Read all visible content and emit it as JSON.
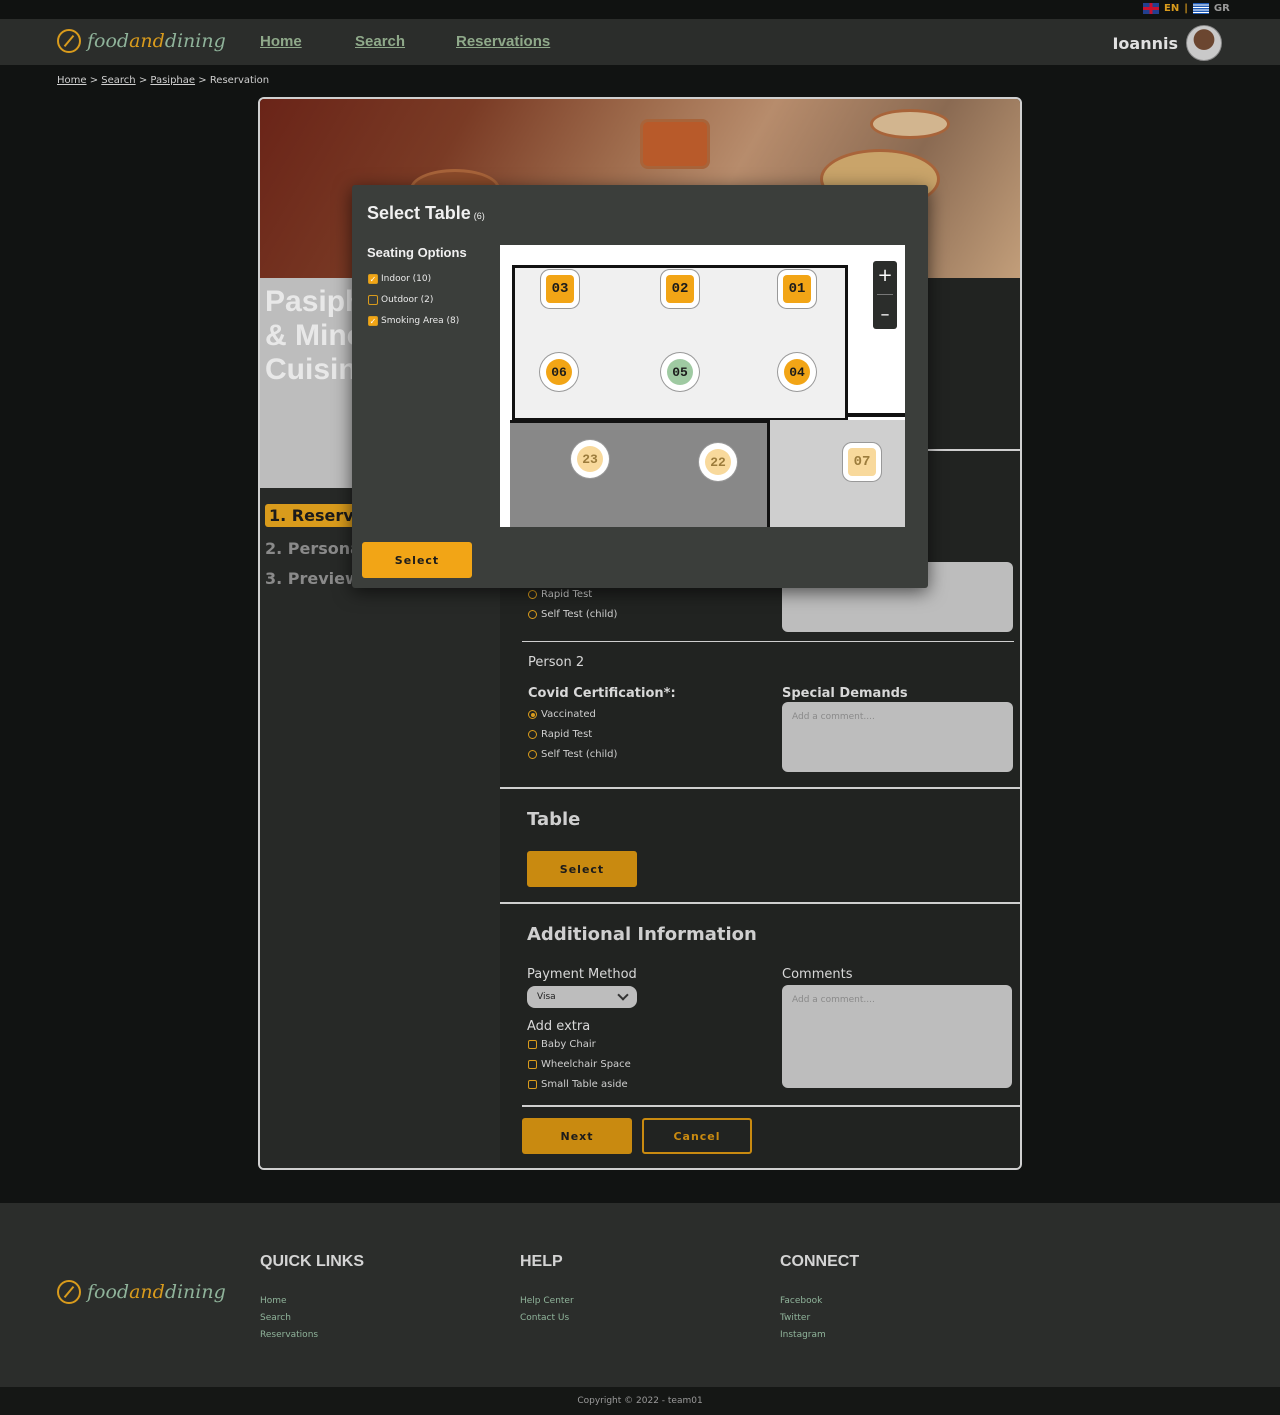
{
  "lang": {
    "en": "EN",
    "gr": "GR"
  },
  "brand": {
    "pre": "food",
    "mid": "and",
    "post": "dining"
  },
  "nav": {
    "home": "Home",
    "search": "Search",
    "reservations": "Reservations"
  },
  "user": {
    "name": "Ioannis"
  },
  "breadcrumb": {
    "home": "Home",
    "search": "Search",
    "place": "Pasiphae",
    "current": "Reservation"
  },
  "restaurant": {
    "title_lines": [
      "Pasiphae",
      "& Minoan",
      "Cuisine"
    ]
  },
  "steps": [
    "1. Reservation",
    "2. Personal",
    "3. Preview"
  ],
  "form": {
    "p1_radios": [
      "Rapid Test",
      "Self Test (child)"
    ],
    "person2": "Person 2",
    "covid_label": "Covid Certification*:",
    "special_label": "Special Demands",
    "covid_options": [
      "Vaccinated",
      "Rapid Test",
      "Self Test (child)"
    ],
    "comment_placeholder": "Add a comment....",
    "table_heading": "Table",
    "table_button": "Select",
    "additional_heading": "Additional Information",
    "payment_label": "Payment Method",
    "payment_value": "Visa",
    "comments_label": "Comments",
    "extra_label": "Add extra",
    "extras": [
      "Baby Chair",
      "Wheelchair Space",
      "Small Table aside"
    ],
    "next": "Next",
    "cancel": "Cancel"
  },
  "modal": {
    "title": "Select Table",
    "count": "(6)",
    "seating_heading": "Seating Options",
    "options": [
      {
        "label": "Indoor (10)",
        "checked": true
      },
      {
        "label": "Outdoor (2)",
        "checked": false
      },
      {
        "label": "Smoking Area (8)",
        "checked": true
      }
    ],
    "tables": [
      "03",
      "02",
      "01",
      "06",
      "05",
      "04",
      "23",
      "22",
      "07"
    ],
    "zoom_in": "+",
    "zoom_out": "–",
    "select_button": "Select"
  },
  "footer": {
    "quick_links": "QUICK LINKS",
    "help": "HELP",
    "connect": "CONNECT",
    "ql": [
      "Home",
      "Search",
      "Reservations"
    ],
    "hl": [
      "Help Center",
      "Contact Us"
    ],
    "cl": [
      "Facebook",
      "Twitter",
      "Instagram"
    ],
    "copyright": "Copyright © 2022 - team01"
  },
  "colors": {
    "accent": "#f2a516",
    "accent_dark": "#c98a10",
    "selected_table": "#9fcaa2"
  }
}
